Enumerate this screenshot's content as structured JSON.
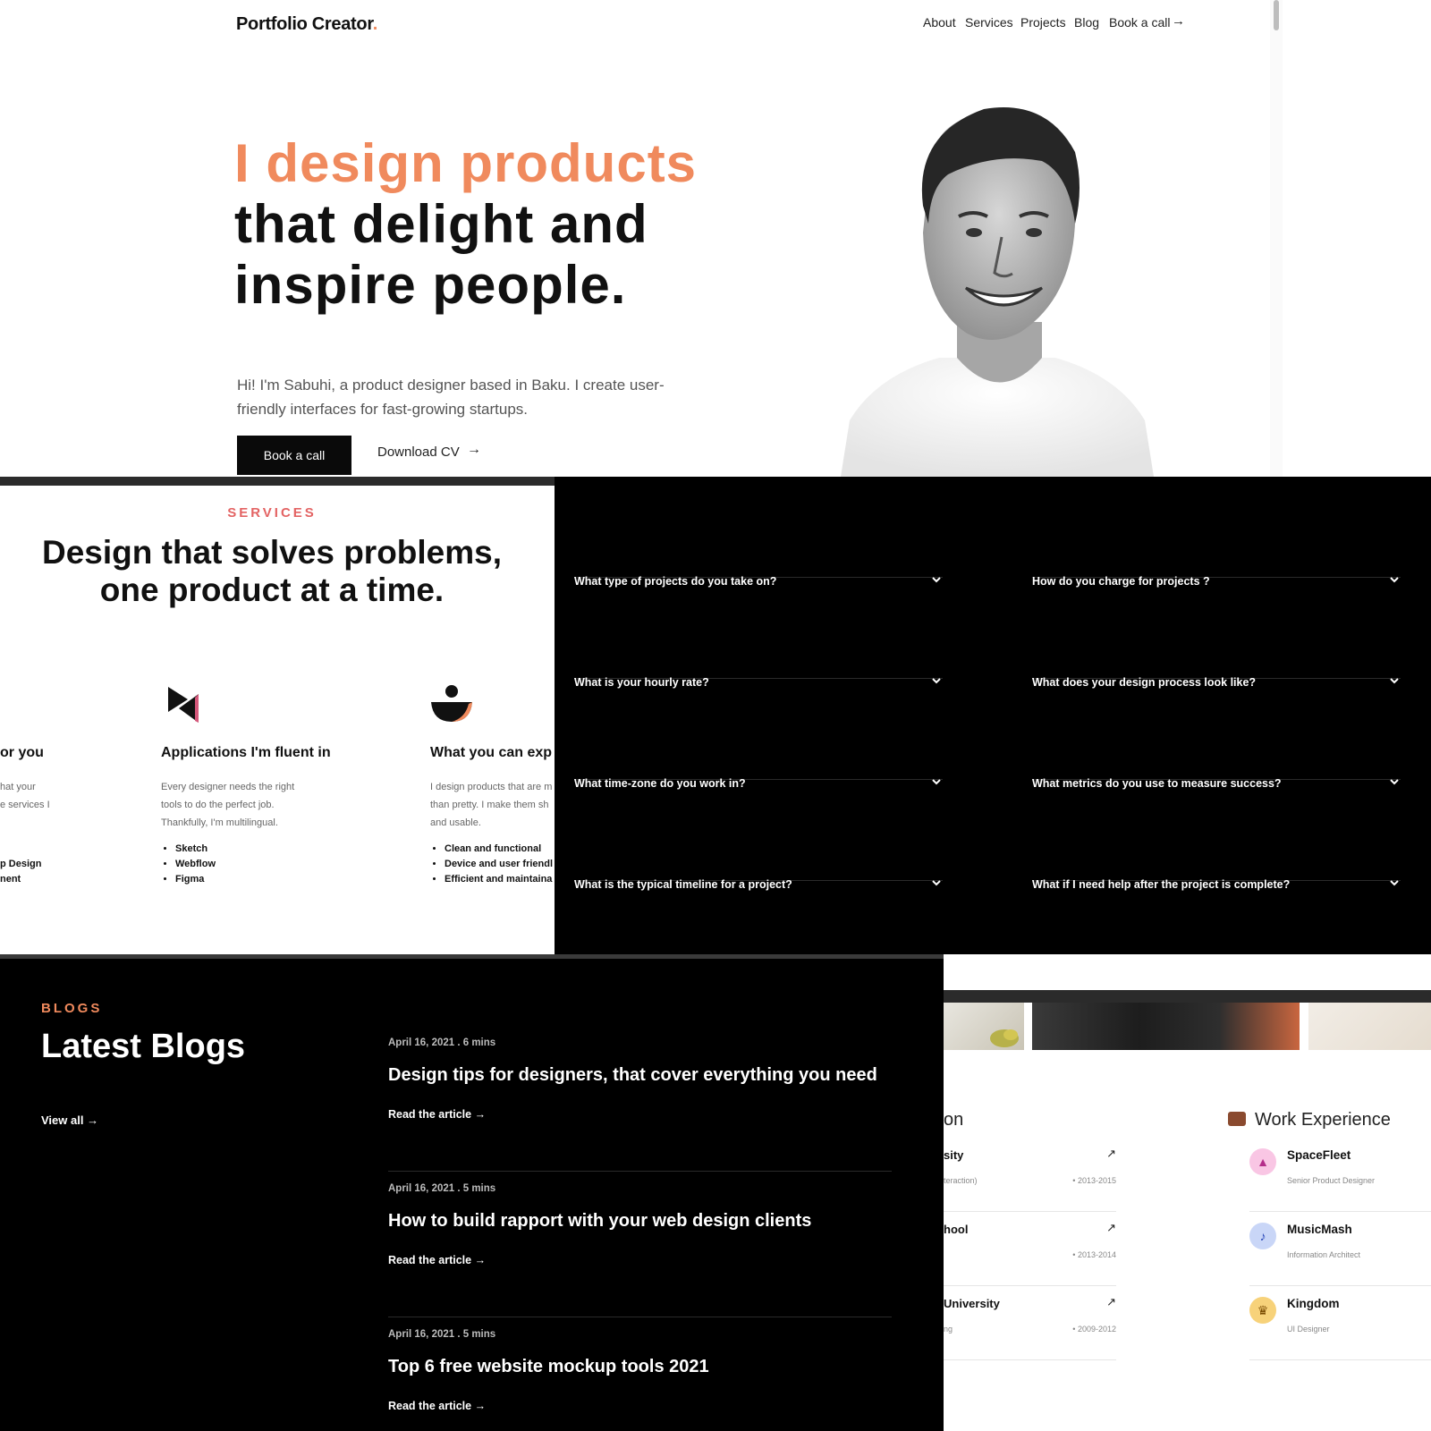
{
  "hero": {
    "logo": "Portfolio Creator",
    "logo_dot": ".",
    "nav": [
      "About",
      "Services",
      "Projects",
      "Blog",
      "Book a call"
    ],
    "headline": [
      "I design products",
      "that delight and",
      "inspire people."
    ],
    "intro": "Hi! I'm Sabuhi, a product designer based in Baku. I create user-friendly interfaces for fast-growing startups.",
    "cta_primary": "Book a call",
    "cta_secondary": "Download CV",
    "accent_color": "#f08a5d"
  },
  "services": {
    "eyebrow": "SERVICES",
    "title_line1": "Design that solves problems,",
    "title_line2": "one product at a time.",
    "columns": [
      {
        "heading": "or you",
        "desc": [
          "hat your",
          "e services I"
        ],
        "items": [
          "p Design",
          "nent"
        ]
      },
      {
        "heading": "Applications I'm fluent in",
        "desc": [
          "Every designer needs the right",
          "tools to do the perfect job.",
          "Thankfully, I'm multilingual."
        ],
        "items": [
          "Sketch",
          "Webflow",
          "Figma"
        ]
      },
      {
        "heading": "What you can exp",
        "desc": [
          "I design products that are m",
          "than pretty. I make them sh",
          "and usable."
        ],
        "items": [
          "Clean and functional",
          "Device and user friendl",
          "Efficient and maintaina"
        ]
      }
    ],
    "accent_color": "#e36363"
  },
  "faq": {
    "left": [
      "What type of projects do you take on?",
      "What is your hourly rate?",
      "What time-zone do you work in?",
      "What is the typical timeline for a project?"
    ],
    "right": [
      "How do you charge for projects ?",
      "What does your design process look like?",
      "What metrics do you use to measure success?",
      "What if I need help after the project is complete?"
    ]
  },
  "blogs": {
    "eyebrow": "BLOGS",
    "title": "Latest Blogs",
    "view_all": "View all →",
    "posts": [
      {
        "meta": "April 16, 2021 . 6 mins",
        "title": "Design tips for designers, that cover everything you need",
        "read": "Read the article →"
      },
      {
        "meta": "April 16, 2021 . 5 mins",
        "title": "How to build rapport with your web design clients",
        "read": "Read the article →"
      },
      {
        "meta": "April 16, 2021 . 5 mins",
        "title": "Top 6 free website mockup tools 2021",
        "read": "Read the article →"
      }
    ]
  },
  "resume": {
    "education_title": "on",
    "work_title": "Work Experience",
    "education": [
      {
        "name": "sity",
        "sub": "teraction)",
        "years": "• 2013-2015"
      },
      {
        "name": "hool",
        "sub": "",
        "years": "• 2013-2014"
      },
      {
        "name": "University",
        "sub": "ng",
        "years": "• 2009-2012"
      }
    ],
    "work": [
      {
        "name": "SpaceFleet",
        "role": "Senior Product Designer",
        "icon": "rocket-icon",
        "color": "#f9c6e4"
      },
      {
        "name": "MusicMash",
        "role": "Information Architect",
        "icon": "music-note-icon",
        "color": "#c9d6f7"
      },
      {
        "name": "Kingdom",
        "role": "UI Designer",
        "icon": "crown-icon",
        "color": "#f7d27a"
      }
    ]
  }
}
